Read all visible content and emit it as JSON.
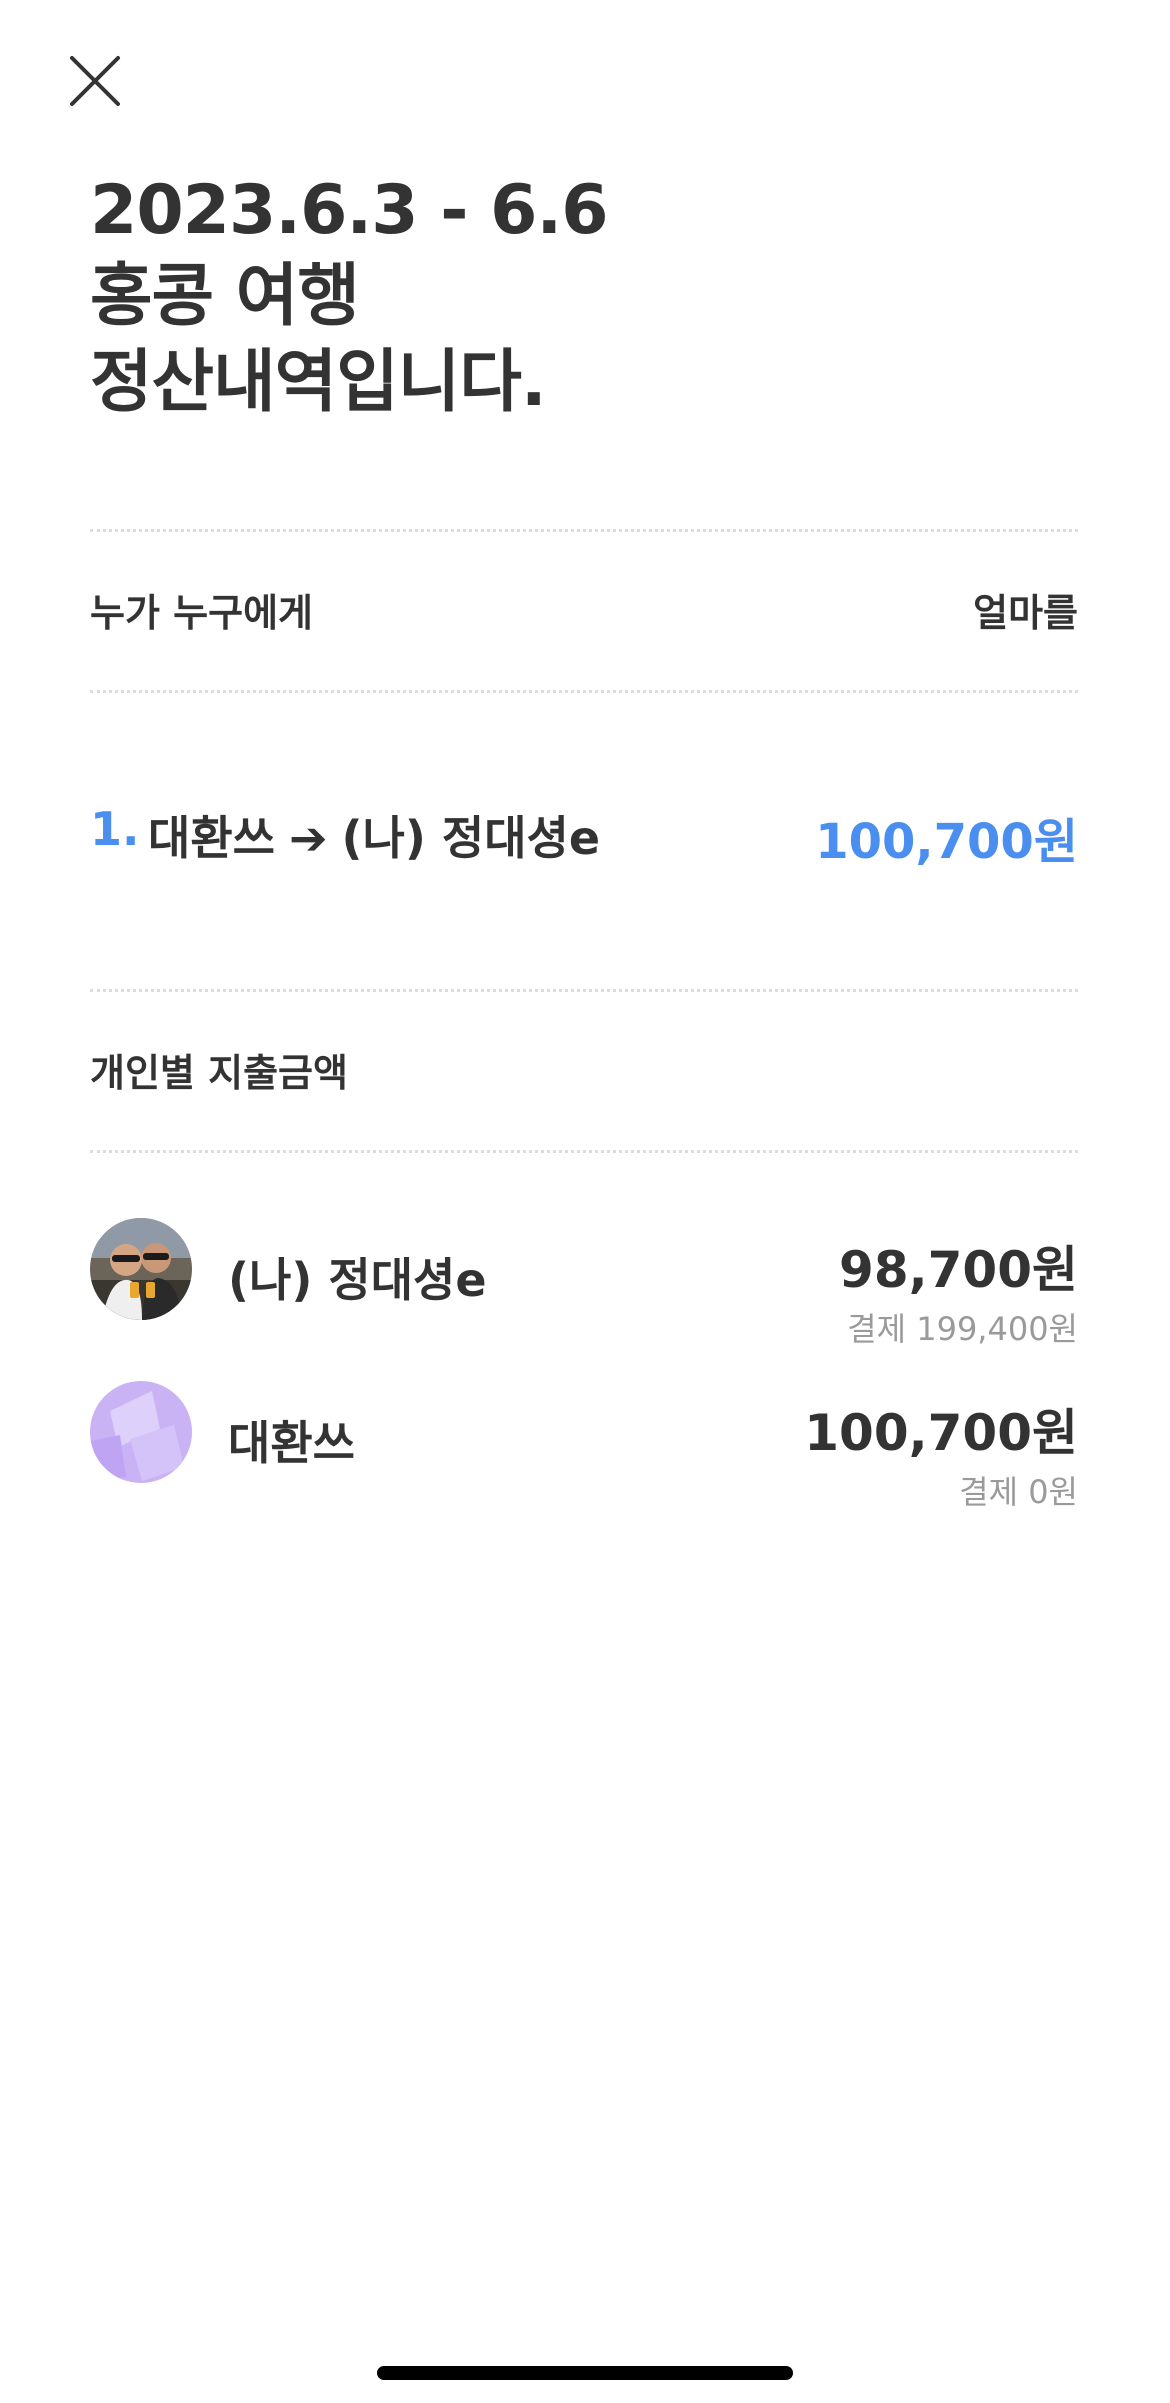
{
  "header": {
    "close_icon": "close-icon",
    "title_line1": "2023.6.3 - 6.6",
    "title_line2": "홍콩 여행",
    "title_line3": "정산내역입니다."
  },
  "settlement": {
    "col_who": "누가 누구에게",
    "col_amount": "얼마를",
    "items": [
      {
        "number": "1.",
        "from": "대환쓰",
        "arrow": "➔",
        "to": "(나) 정대셩e",
        "amount": "100,700원"
      }
    ]
  },
  "individual": {
    "title": "개인별 지출금액",
    "people": [
      {
        "name": "(나) 정대셩e",
        "amount": "98,700원",
        "paid": "결제 199,400원",
        "avatar": "photo-avatar"
      },
      {
        "name": "대환쓰",
        "amount": "100,700원",
        "paid": "결제 0원",
        "avatar": "default-avatar"
      }
    ]
  },
  "colors": {
    "accent": "#4a8ef0",
    "text": "#333333",
    "muted": "#9a9a9a",
    "divider": "#dcdcdc",
    "default_avatar": "#c9b3f5"
  }
}
